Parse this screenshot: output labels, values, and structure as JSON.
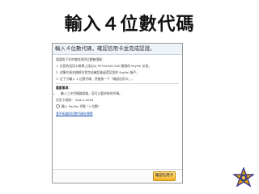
{
  "slide": {
    "title": "輸入４位數代碼"
  },
  "panel": {
    "header": "輸入４位數代碼，確認信用卡並完成認證。",
    "intro": "請遵照下列步驟找到四位數驗證碼：",
    "steps": [
      "在您的信用卡帳單上找出以 PP*XXXXCODE 開頭的 PayPal 交易。",
      "這筆交易金額將在您完成確認後退還至您的 PayPal 帳戶。",
      "在下方輸入 4 位數代碼，然後按一下「確認信用卡」。"
    ],
    "important_title": "重要事項：",
    "important_items": [
      "輸入三次代碼錯誤後，您可以要求新的代碼。"
    ],
    "card_label": "信用卡號碼：",
    "card_value": "Visa x-2016",
    "code_label": "輸入 PayPal 代碼（4 位數）",
    "help_link": "我不知道四位數代碼在哪裡",
    "confirm_button": "確認信用卡"
  }
}
